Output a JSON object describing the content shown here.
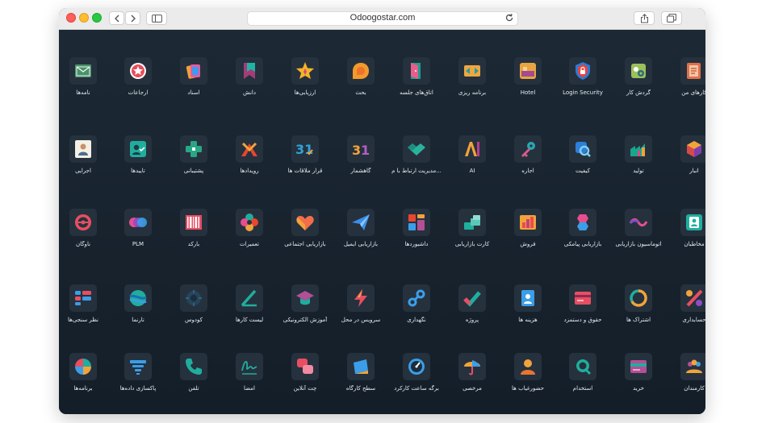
{
  "browser": {
    "url": "Odoogostar.com"
  },
  "apps": [
    {
      "label": "کارهای من",
      "icon": "notebook-pen-icon"
    },
    {
      "label": "گردش کار",
      "icon": "workflow-gear-icon"
    },
    {
      "label": "Login Security",
      "icon": "shield-lock-icon"
    },
    {
      "label": "Hotel",
      "icon": "hotel-bed-icon"
    },
    {
      "label": "برنامه ریزی",
      "icon": "planning-arrows-icon"
    },
    {
      "label": "اتاق‌های جلسه",
      "icon": "meeting-room-door-icon"
    },
    {
      "label": "بحث",
      "icon": "discuss-bubble-icon"
    },
    {
      "label": "ارزیابی‌ها",
      "icon": "star-icon"
    },
    {
      "label": "دانش",
      "icon": "knowledge-bookmark-icon"
    },
    {
      "label": "اسناد",
      "icon": "documents-icon"
    },
    {
      "label": "ارجاعات",
      "icon": "referral-star-badge-icon"
    },
    {
      "label": "نامه‌ها",
      "icon": "mail-envelope-icon"
    },
    {
      "label": "انبار",
      "icon": "inventory-cube-icon"
    },
    {
      "label": "تولید",
      "icon": "manufacturing-factory-icon"
    },
    {
      "label": "کیفیت",
      "icon": "quality-magnifier-icon"
    },
    {
      "label": "اجاره",
      "icon": "rental-key-icon"
    },
    {
      "label": "AI",
      "icon": "ai-letters-icon"
    },
    {
      "label": "مدیریت ارتباط با م...",
      "icon": "crm-handshake-icon"
    },
    {
      "label": "گاهشمار",
      "icon": "calendar-31-icon"
    },
    {
      "label": "قرار ملاقات ها",
      "icon": "appointment-calendar-check-icon"
    },
    {
      "label": "رویدادها",
      "icon": "events-ribbon-icon"
    },
    {
      "label": "پشتیبانی",
      "icon": "helpdesk-cross-icon"
    },
    {
      "label": "تاییدها",
      "icon": "approvals-user-check-icon"
    },
    {
      "label": "اجرایی",
      "icon": "executive-photo-icon"
    },
    {
      "label": "مخاطبان",
      "icon": "contacts-card-icon"
    },
    {
      "label": "اتوماسیون بازاریابی",
      "icon": "marketing-automation-icon"
    },
    {
      "label": "بازاریابی پیامکی",
      "icon": "sms-marketing-icon"
    },
    {
      "label": "فروش",
      "icon": "sales-bars-icon"
    },
    {
      "label": "کارت بازاریابی",
      "icon": "marketing-card-icon"
    },
    {
      "label": "داشبوردها",
      "icon": "dashboard-grid-icon"
    },
    {
      "label": "بازاریابی ایمیل",
      "icon": "email-paper-plane-icon"
    },
    {
      "label": "بازاریابی اجتماعی",
      "icon": "social-heart-icon"
    },
    {
      "label": "تعمیرات",
      "icon": "repairs-flower-icon"
    },
    {
      "label": "بارکد",
      "icon": "barcode-icon"
    },
    {
      "label": "PLM",
      "icon": "plm-circles-icon"
    },
    {
      "label": "ناوگان",
      "icon": "fleet-steering-wheel-icon"
    },
    {
      "label": "حسابداری",
      "icon": "accounting-percent-icon"
    },
    {
      "label": "اشتراک ها",
      "icon": "subscriptions-cycle-icon"
    },
    {
      "label": "حقوق و دستمزد",
      "icon": "payroll-card-icon"
    },
    {
      "label": "هزینه ها",
      "icon": "expenses-receipt-icon"
    },
    {
      "label": "پروژه",
      "icon": "project-check-icon"
    },
    {
      "label": "نگهداری",
      "icon": "maintenance-wrench-icon"
    },
    {
      "label": "سرویس در محل",
      "icon": "field-service-bolt-icon"
    },
    {
      "label": "آموزش الکترونیکی",
      "icon": "elearning-cap-icon"
    },
    {
      "label": "لیست کارها",
      "icon": "todo-pen-icon"
    },
    {
      "label": "کودوس",
      "icon": "kudos-gear-icon"
    },
    {
      "label": "تارنما",
      "icon": "website-globe-icon"
    },
    {
      "label": "نظر سنجی‌ها",
      "icon": "surveys-list-icon"
    },
    {
      "label": "کارمندان",
      "icon": "employees-group-icon"
    },
    {
      "label": "خرید",
      "icon": "purchase-card-icon"
    },
    {
      "label": "استخدام",
      "icon": "recruitment-search-icon"
    },
    {
      "label": "حضورغیاب ها",
      "icon": "attendance-user-icon"
    },
    {
      "label": "مرخصی",
      "icon": "time-off-umbrella-icon"
    },
    {
      "label": "برگه ساعت کارکرد",
      "icon": "timesheet-gauge-icon"
    },
    {
      "label": "سطح کارگاه",
      "icon": "shop-floor-icon"
    },
    {
      "label": "چت آنلاین",
      "icon": "live-chat-icon"
    },
    {
      "label": "امضا",
      "icon": "sign-signature-icon"
    },
    {
      "label": "تلفن",
      "icon": "phone-handset-icon"
    },
    {
      "label": "پاکسازی داده‌ها",
      "icon": "data-cleaning-funnel-icon"
    },
    {
      "label": "برنامه‌ها",
      "icon": "apps-pie-icon"
    }
  ]
}
